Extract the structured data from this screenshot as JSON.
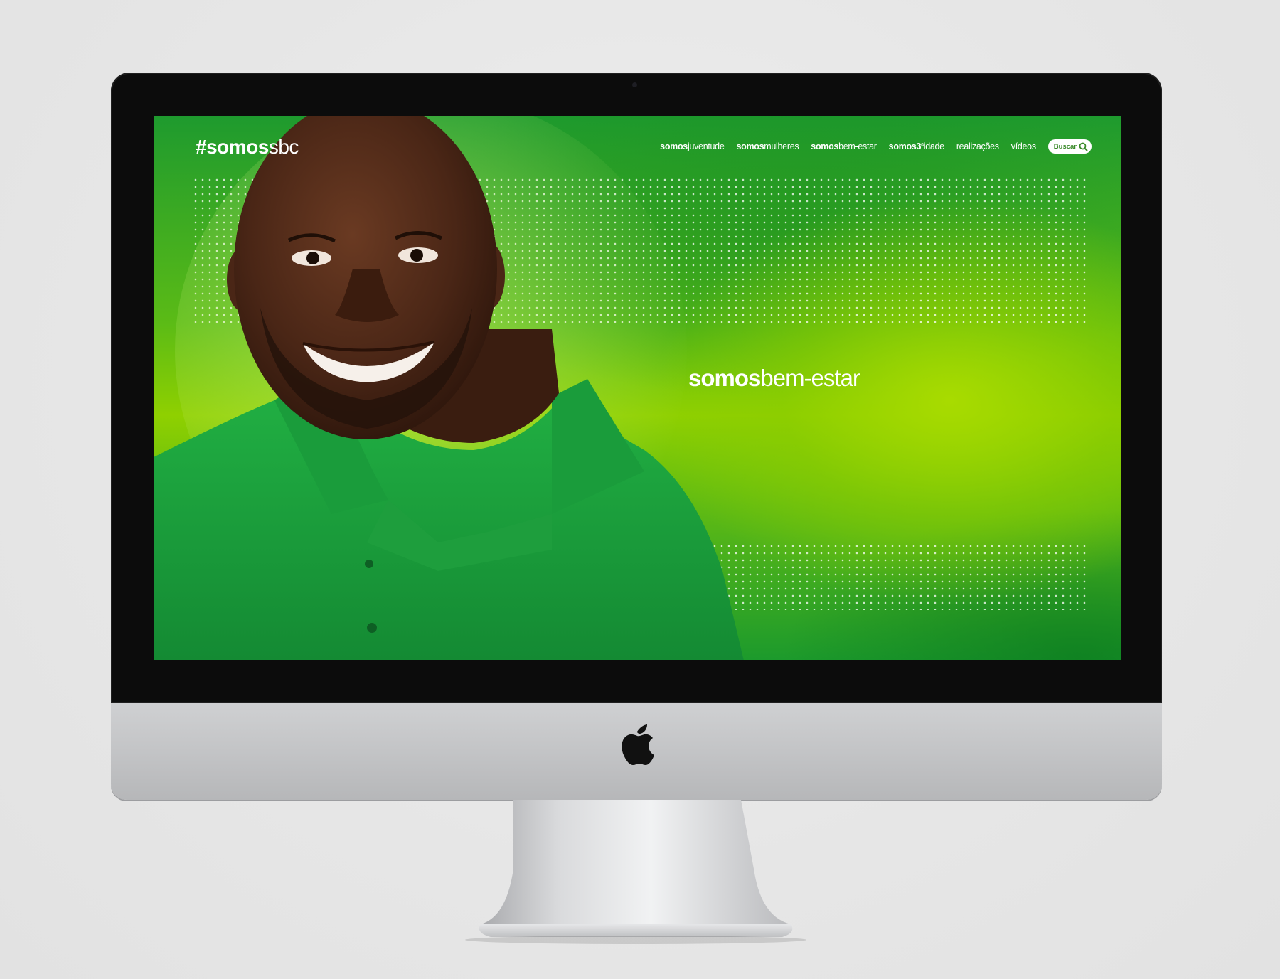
{
  "site": {
    "logo_bold": "#somos",
    "logo_light": "sbc"
  },
  "nav": {
    "items": [
      {
        "bold": "somos",
        "light": "juventude"
      },
      {
        "bold": "somos",
        "light": "mulheres"
      },
      {
        "bold": "somos",
        "light": "bem-estar"
      },
      {
        "bold": "somos",
        "light_a": "3",
        "sup": "a",
        "light_b": "idade"
      },
      {
        "light": "realizações"
      },
      {
        "light": "vídeos"
      }
    ],
    "search_label": "Buscar"
  },
  "hero": {
    "title_bold": "somos",
    "title_light": "bem-estar"
  },
  "icons": {
    "apple": "apple-icon",
    "search": "search-icon"
  },
  "colors": {
    "brand_green": "#1e9a2e",
    "accent_lime": "#8fd000",
    "shirt_green": "#1aa43c"
  }
}
